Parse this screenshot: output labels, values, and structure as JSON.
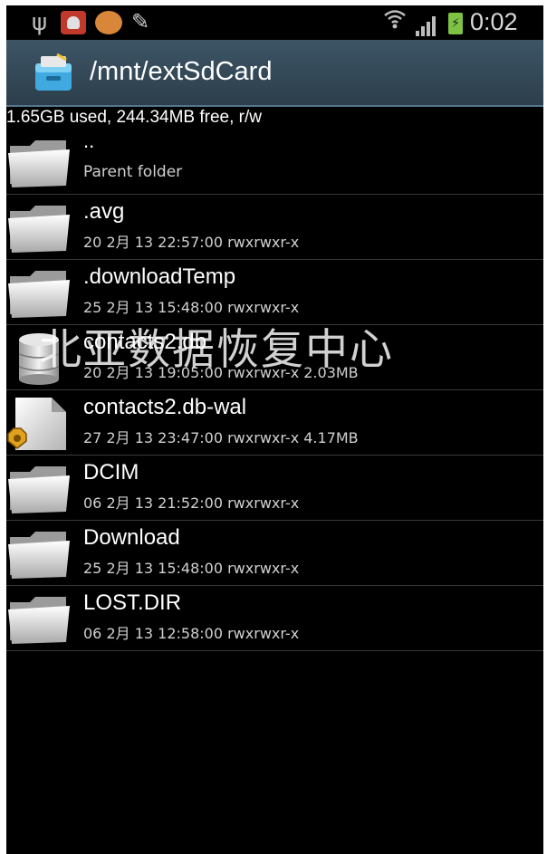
{
  "status_bar": {
    "time": "0:02",
    "icons": [
      "usb-icon",
      "notification-icon",
      "notification-icon",
      "pencil-icon",
      "wifi-icon",
      "signal-icon",
      "battery-icon"
    ]
  },
  "title_bar": {
    "path": "/mnt/extSdCard",
    "app_icon": "file-manager-icon"
  },
  "storage_info": "1.65GB used, 244.34MB free, r/w",
  "files": [
    {
      "name": "..",
      "meta": "Parent folder",
      "icon": "folder-icon"
    },
    {
      "name": ".avg",
      "meta": "20 2月 13 22:57:00  rwxrwxr-x",
      "icon": "folder-icon"
    },
    {
      "name": ".downloadTemp",
      "meta": "25 2月 13 15:48:00  rwxrwxr-x",
      "icon": "folder-icon"
    },
    {
      "name": "contacts2.db",
      "meta": "20 2月 13 19:05:00  rwxrwxr-x  2.03MB",
      "icon": "database-icon"
    },
    {
      "name": "contacts2.db-wal",
      "meta": "27 2月 13 23:47:00  rwxrwxr-x  4.17MB",
      "icon": "file-icon"
    },
    {
      "name": "DCIM",
      "meta": "06 2月 13 21:52:00  rwxrwxr-x",
      "icon": "folder-icon"
    },
    {
      "name": "Download",
      "meta": "25 2月 13 15:48:00  rwxrwxr-x",
      "icon": "folder-icon"
    },
    {
      "name": "LOST.DIR",
      "meta": "06 2月 13 12:58:00  rwxrwxr-x",
      "icon": "folder-icon"
    }
  ],
  "watermark": "北亚数据恢复中心"
}
